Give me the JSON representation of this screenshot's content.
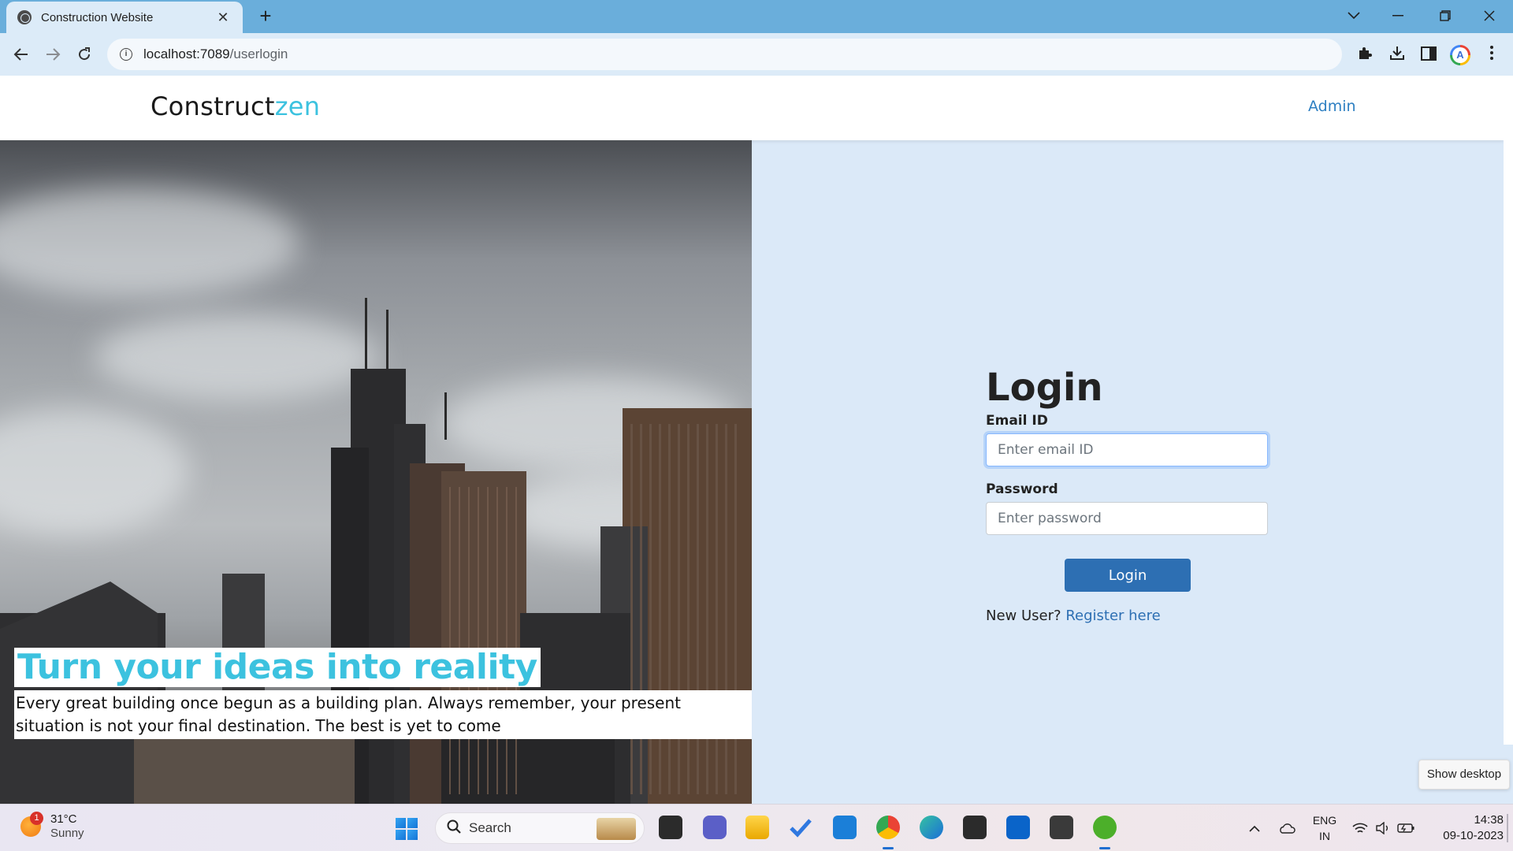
{
  "browser": {
    "tab_title": "Construction Website",
    "tab_close": "✕",
    "new_tab": "+",
    "url_host": "localhost:7089",
    "url_path": "/userlogin"
  },
  "header": {
    "brand_main": "Construct",
    "brand_accent": "zen",
    "admin_link": "Admin"
  },
  "hero": {
    "title": "Turn your ideas into reality",
    "text": "Every great building once begun as a building plan. Always remember, your present situation is not your final destination. The best is yet to come"
  },
  "login": {
    "title": "Login",
    "email_label": "Email ID",
    "email_placeholder": "Enter email ID",
    "password_label": "Password",
    "password_placeholder": "Enter password",
    "button": "Login",
    "new_user_text": "New User?",
    "register_link": "Register here"
  },
  "tooltip": "Show desktop",
  "taskbar": {
    "weather_badge": "1",
    "temperature": "31°C",
    "condition": "Sunny",
    "search_label": "Search",
    "lang_1": "ENG",
    "lang_2": "IN",
    "time": "14:38",
    "date": "09-10-2023"
  },
  "colors": {
    "accent": "#3cc2df",
    "link": "#2d7fc2",
    "button": "#2d6fb3",
    "page_bg": "#dbe9f8"
  }
}
